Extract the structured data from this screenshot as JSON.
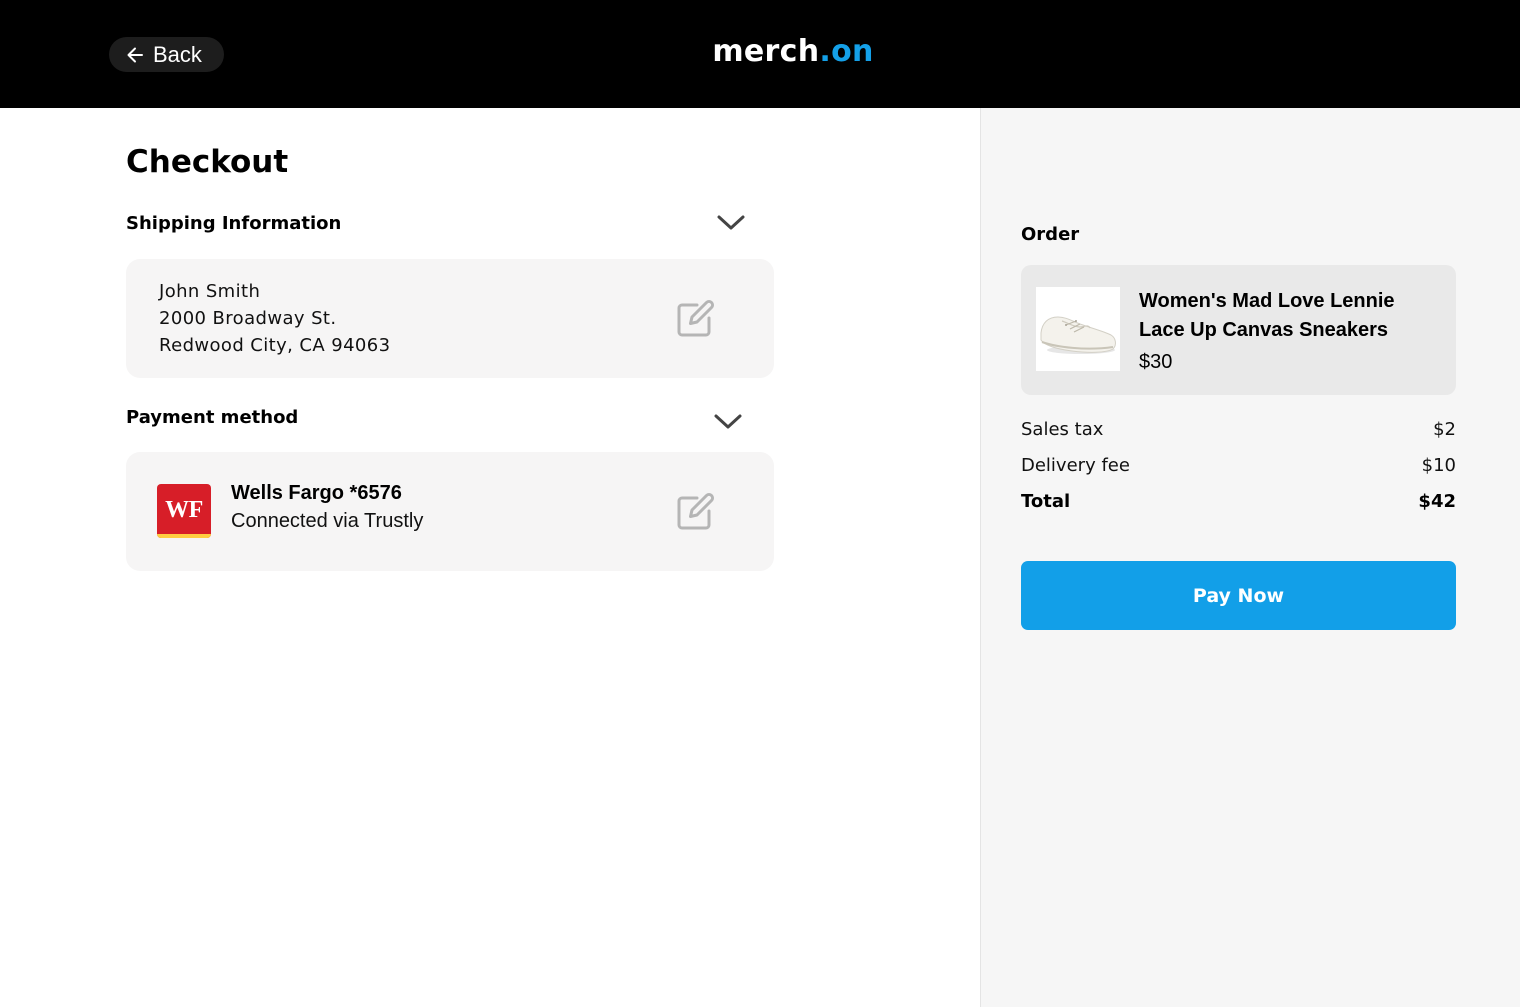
{
  "header": {
    "back_label": "Back",
    "logo_main": "merch",
    "logo_accent": ".on",
    "back_icon": "arrow-left-icon"
  },
  "checkout": {
    "title": "Checkout",
    "shipping": {
      "heading": "Shipping Information",
      "name": "John Smith",
      "street": "2000 Broadway St.",
      "city_line": "Redwood City, CA 94063",
      "icons": {
        "toggle": "chevron-down-icon",
        "edit": "edit-icon"
      }
    },
    "payment": {
      "heading": "Payment method",
      "bank_logo_text": "WF",
      "account": "Wells Fargo *6576",
      "connection": "Connected via Trustly",
      "icons": {
        "toggle": "chevron-down-icon",
        "edit": "edit-icon"
      }
    }
  },
  "order": {
    "heading": "Order",
    "item": {
      "name": "Women's Mad Love Lennie Lace Up Canvas Sneakers",
      "price": "$30"
    },
    "summary": [
      {
        "label": "Sales tax",
        "value": "$2"
      },
      {
        "label": "Delivery fee",
        "value": "$10"
      },
      {
        "label": "Total",
        "value": "$42"
      }
    ],
    "pay_button": "Pay Now"
  },
  "colors": {
    "header_bg": "#000000",
    "accent": "#129fe8",
    "card_bg": "#f6f5f5",
    "sidebar_bg": "#f6f6f6",
    "bank_red": "#d71e28",
    "bank_gold": "#ffcd41"
  }
}
